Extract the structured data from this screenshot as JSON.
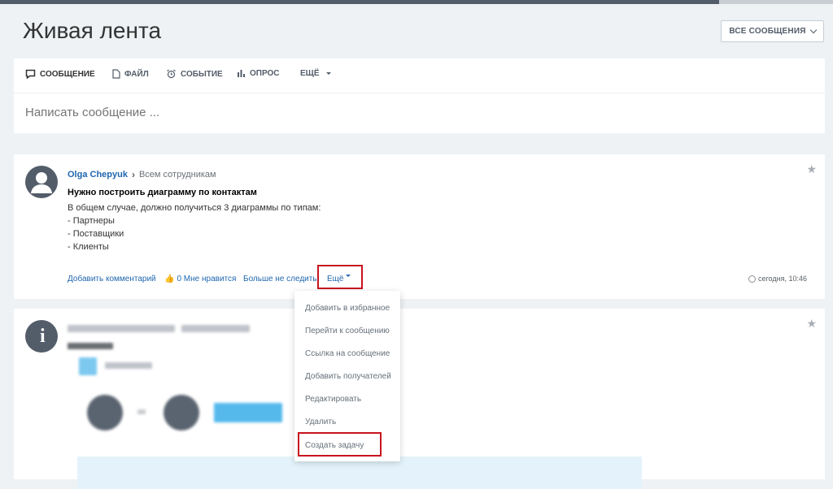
{
  "header": {
    "title": "Живая лента",
    "filter_label": "ВСЕ СООБЩЕНИЯ"
  },
  "composer": {
    "tabs": [
      {
        "label": "СООБЩЕНИЕ",
        "icon": "message-icon"
      },
      {
        "label": "ФАЙЛ",
        "icon": "file-icon"
      },
      {
        "label": "СОБЫТИЕ",
        "icon": "alarm-clock-icon"
      },
      {
        "label": "ОПРОС",
        "icon": "poll-icon"
      },
      {
        "label": "ЕЩЁ",
        "icon": "caret-down-icon"
      }
    ],
    "placeholder": "Написать сообщение ..."
  },
  "post1": {
    "author": "Olga Chepyuk",
    "recipients": "Всем сотрудникам",
    "title": "Нужно построить диаграмму по контактам",
    "body_lines": [
      "В общем случае, должно получиться 3 диаграммы по типам:",
      "- Партнеры",
      "- Поставщики",
      "- Клиенты"
    ],
    "actions": {
      "comment": "Добавить комментарий",
      "like_count": "0",
      "like": "Мне нравится",
      "unfollow": "Больше не следить",
      "more": "Ещё"
    },
    "time": "сегодня, 10:46"
  },
  "dropdown": {
    "items": [
      "Добавить в избранное",
      "Перейти к сообщению",
      "Ссылка на сообщение",
      "Добавить получателей",
      "Редактировать",
      "Удалить",
      "Создать задачу"
    ]
  },
  "colors": {
    "accent": "#2067b0",
    "highlight": "#c7131f",
    "avatar": "#535c69"
  }
}
